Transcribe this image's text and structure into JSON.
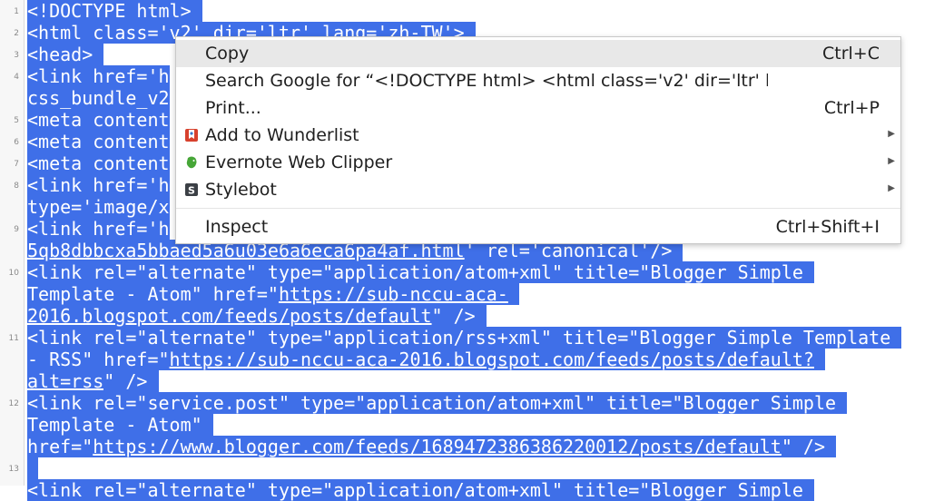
{
  "editor": {
    "line_numbers": [
      "1",
      "2",
      "3",
      "4",
      "5",
      "6",
      "7",
      "8",
      "9",
      "10",
      "11",
      "12",
      "13"
    ],
    "lines": [
      [
        {
          "t": "<!DOCTYPE html> "
        }
      ],
      [
        {
          "t": "<html class='v2' dir='ltr' lang='zh-TW'> "
        }
      ],
      [
        {
          "t": "<head> "
        }
      ],
      [
        {
          "t": "<link href='h"
        }
      ],
      [
        {
          "t": "css_bundle_v2"
        }
      ],
      [
        {
          "t": "<meta content"
        }
      ],
      [
        {
          "t": "<meta content"
        }
      ],
      [
        {
          "t": "<meta content"
        }
      ],
      [
        {
          "t": "<link href='h"
        }
      ],
      [
        {
          "t": "type='image/x"
        }
      ],
      [
        {
          "t": "<link href='h"
        }
      ],
      [
        {
          "t": "5qb8dbbcxa5bbaed5a6u03e6a6eca6pa4af.html",
          "u": true
        },
        {
          "t": "' rel='canonical'/> "
        }
      ],
      [
        {
          "t": "<link rel=\"alternate\" type=\"application/atom+xml\" title=\"Blogger Simple "
        }
      ],
      [
        {
          "t": "Template - Atom\" href=\""
        },
        {
          "t": "https://sub-nccu-aca-",
          "u": true
        },
        {
          "t": " "
        }
      ],
      [
        {
          "t": "2016.blogspot.com/feeds/posts/default",
          "u": true
        },
        {
          "t": "\" /> "
        }
      ],
      [
        {
          "t": "<link rel=\"alternate\" type=\"application/rss+xml\" title=\"Blogger Simple Template "
        }
      ],
      [
        {
          "t": "- RSS\" href=\""
        },
        {
          "t": "https://sub-nccu-aca-2016.blogspot.com/feeds/posts/default?",
          "u": true
        },
        {
          "t": " "
        }
      ],
      [
        {
          "t": "alt=rss",
          "u": true
        },
        {
          "t": "\" /> "
        }
      ],
      [
        {
          "t": "<link rel=\"service.post\" type=\"application/atom+xml\" title=\"Blogger Simple "
        }
      ],
      [
        {
          "t": "Template - Atom\" "
        }
      ],
      [
        {
          "t": "href=\""
        },
        {
          "t": "https://www.blogger.com/feeds/1689472386386220012/posts/default",
          "u": true
        },
        {
          "t": "\" /> "
        }
      ],
      [
        {
          "t": " "
        }
      ],
      [
        {
          "t": "<link rel=\"alternate\" type=\"application/atom+xml\" title=\"Blogger Simple "
        }
      ]
    ]
  },
  "context_menu": {
    "copy": {
      "label": "Copy",
      "shortcut": "Ctrl+C"
    },
    "search": {
      "label": "Search Google for “<!DOCTYPE html> <html class='v2' dir='ltr' l"
    },
    "print": {
      "label": "Print...",
      "shortcut": "Ctrl+P"
    },
    "wunderlist": {
      "label": "Add to Wunderlist"
    },
    "evernote": {
      "label": "Evernote Web Clipper"
    },
    "stylebot": {
      "label": "Stylebot"
    },
    "inspect": {
      "label": "Inspect",
      "shortcut": "Ctrl+Shift+I"
    }
  },
  "colors": {
    "selection": "#3f6fe8",
    "menu_active": "#e8e8e8"
  }
}
